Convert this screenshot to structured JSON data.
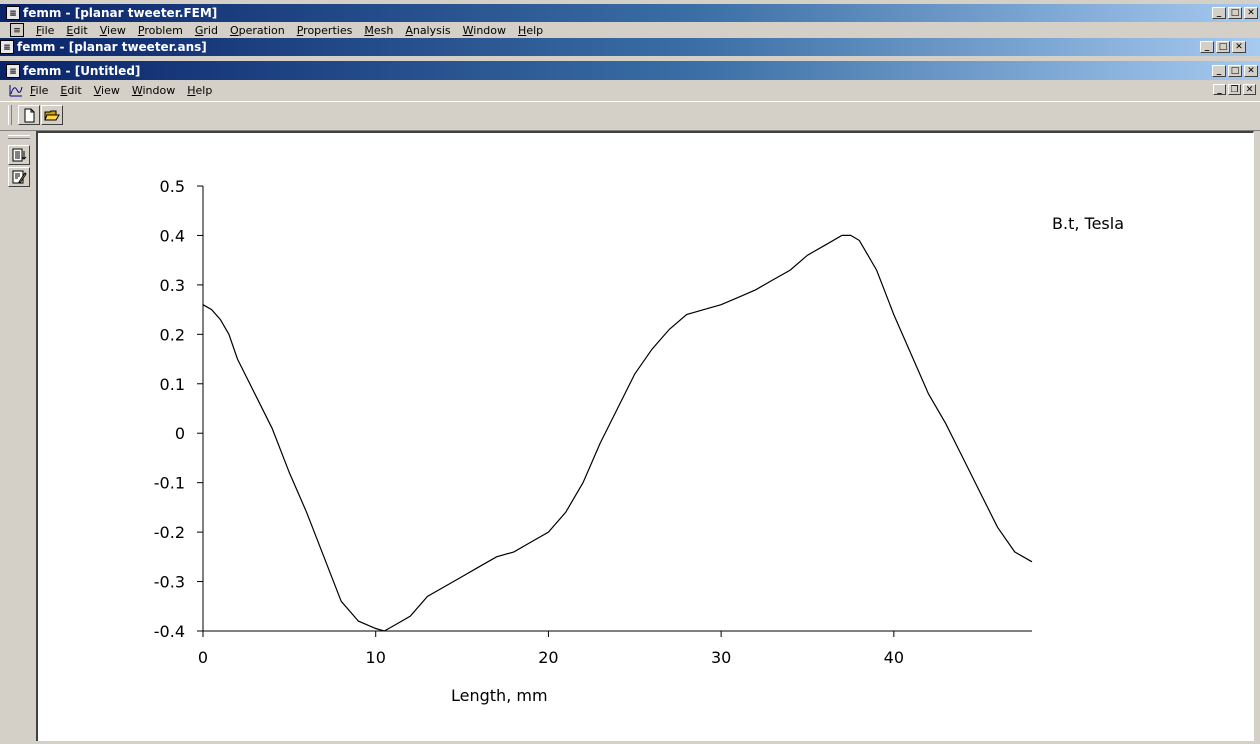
{
  "windows": {
    "fem": {
      "title": "femm - [planar tweeter.FEM]",
      "menu": [
        "File",
        "Edit",
        "View",
        "Problem",
        "Grid",
        "Operation",
        "Properties",
        "Mesh",
        "Analysis",
        "Window",
        "Help"
      ]
    },
    "ans": {
      "title": "femm - [planar tweeter.ans]"
    },
    "untitled": {
      "title": "femm - [Untitled]",
      "menu": [
        "File",
        "Edit",
        "View",
        "Window",
        "Help"
      ]
    }
  },
  "icons": {
    "app": "femm-app-icon",
    "new": "new-document-icon",
    "open": "open-folder-icon",
    "side1": "document-list-icon",
    "side2": "edit-document-icon"
  },
  "window_buttons": {
    "minimize": "_",
    "maximize": "□",
    "restore": "❐",
    "close": "✕"
  },
  "chart_data": {
    "type": "line",
    "title": "",
    "legend": "B.t, Tesla",
    "xlabel": "Length, mm",
    "ylabel": "",
    "xlim": [
      0,
      48
    ],
    "ylim": [
      -0.4,
      0.5
    ],
    "xticks": [
      0,
      10,
      20,
      30,
      40
    ],
    "yticks": [
      0.5,
      0.4,
      0.3,
      0.2,
      0.1,
      0,
      -0.1,
      -0.2,
      -0.3,
      -0.4
    ],
    "ytick_labels": [
      "0.5",
      "0.4",
      "0.3",
      "0.2",
      "0.1",
      "0",
      "-0.1",
      "-0.2",
      "-0.3",
      "-0.4"
    ],
    "series": [
      {
        "x": [
          0,
          0.5,
          1,
          1.5,
          2,
          3,
          4,
          5,
          6,
          7,
          8,
          9,
          10,
          10.5,
          11,
          12,
          13,
          14,
          15,
          16,
          17,
          18,
          19,
          20,
          21,
          22,
          23,
          24,
          25,
          26,
          27,
          28,
          29,
          30,
          31,
          32,
          33,
          34,
          35,
          36,
          37,
          37.5,
          38,
          39,
          40,
          41,
          42,
          43,
          44,
          45,
          46,
          47,
          48
        ],
        "y": [
          0.26,
          0.25,
          0.23,
          0.2,
          0.15,
          0.08,
          0.01,
          -0.08,
          -0.16,
          -0.25,
          -0.34,
          -0.38,
          -0.395,
          -0.4,
          -0.39,
          -0.37,
          -0.33,
          -0.31,
          -0.29,
          -0.27,
          -0.25,
          -0.24,
          -0.22,
          -0.2,
          -0.16,
          -0.1,
          -0.02,
          0.05,
          0.12,
          0.17,
          0.21,
          0.24,
          0.25,
          0.26,
          0.275,
          0.29,
          0.31,
          0.33,
          0.36,
          0.38,
          0.4,
          0.4,
          0.39,
          0.33,
          0.24,
          0.16,
          0.08,
          0.02,
          -0.05,
          -0.12,
          -0.19,
          -0.24,
          -0.26
        ]
      }
    ]
  }
}
